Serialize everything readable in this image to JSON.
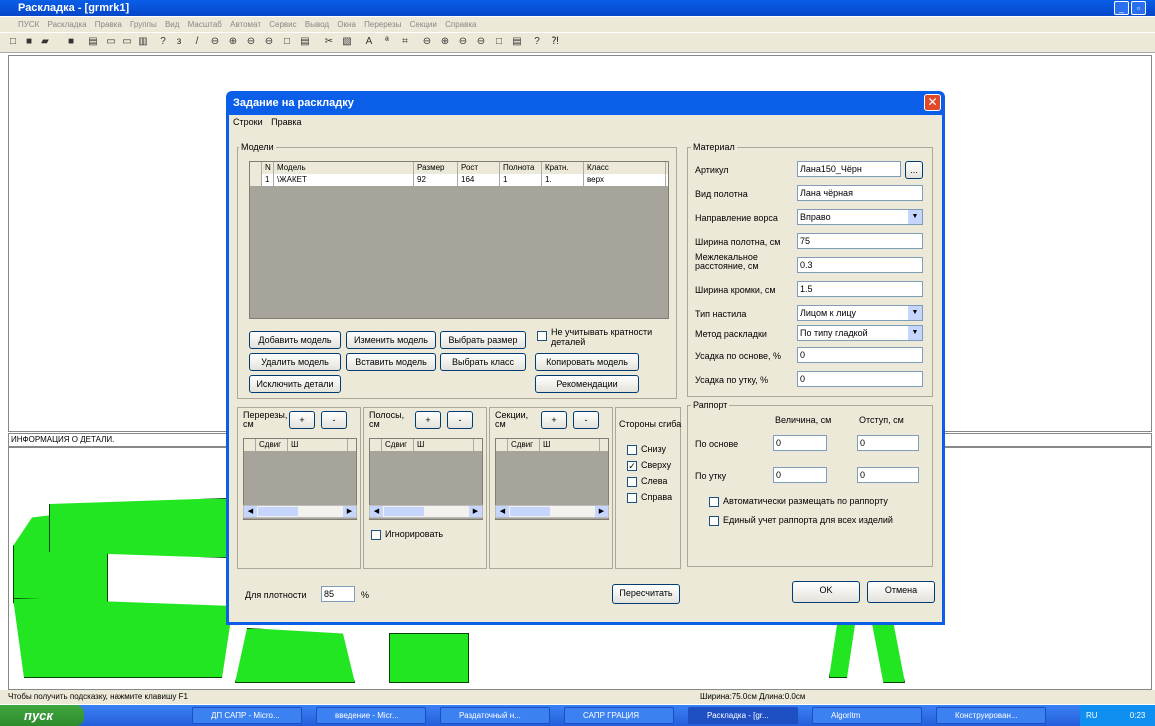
{
  "app": {
    "title": "Раскладка - [grmrk1]",
    "menu": [
      "ПУСК",
      "Раскладка",
      "Правка",
      "Группы",
      "Вид",
      "Масштаб",
      "Автомат",
      "Сервис",
      "Вывод",
      "Окна",
      "Перерезы",
      "Секции",
      "Справка"
    ],
    "info_header": "ИНФОРМАЦИЯ О ДЕТАЛИ.",
    "status_hint": "Чтобы получить подсказку, нажмите клавишу F1",
    "status_size": "Ширина:75.0см Длина:0.0см"
  },
  "dialog": {
    "title": "Задание на раскладку",
    "menu": [
      "Строки",
      "Правка"
    ],
    "models": {
      "label": "Модели",
      "columns": [
        "N",
        "Модель",
        "Размер",
        "Рост",
        "Полнота",
        "Кратн.",
        "Класс"
      ],
      "rows": [
        [
          "1",
          "\\ЖАКЕТ",
          "92",
          "164",
          "1",
          "1.",
          "верх"
        ]
      ],
      "buttons": {
        "add": "Добавить модель",
        "edit": "Изменить модель",
        "pick_size": "Выбрать размер",
        "delete": "Удалить модель",
        "insert": "Вставить модель",
        "pick_class": "Выбрать класс",
        "exclude": "Исключить детали",
        "copy": "Копировать модель",
        "recommend": "Рекомендации"
      },
      "ignore_mult": "Не учитывать кратности деталей"
    },
    "material": {
      "label": "Материал",
      "article_label": "Артикул",
      "article": "Лана150_Чёрн",
      "article_btn": "...",
      "fabric_label": "Вид полотна",
      "fabric": "Лана чёрная",
      "nap_label": "Направление ворса",
      "nap": "Вправо",
      "width_label": "Ширина полотна, см",
      "width": "75",
      "gap_label": "Межлекальное расстояние, см",
      "gap": "0.3",
      "edge_label": "Ширина кромки, см",
      "edge": "1.5",
      "spread_label": "Тип настила",
      "spread": "Лицом к лицу",
      "method_label": "Метод раскладки",
      "method": "По типу гладкой",
      "shrink_warp_label": "Усадка по основе, %",
      "shrink_warp": "0",
      "shrink_weft_label": "Усадка по утку, %",
      "shrink_weft": "0"
    },
    "cuts": {
      "label": "Перерезы, см",
      "plus": "+",
      "minus": "-",
      "cols": [
        "Сдвиг",
        "Ш"
      ]
    },
    "strips": {
      "label": "Полосы, см",
      "plus": "+",
      "minus": "-",
      "cols": [
        "Сдвиг",
        "Ш"
      ],
      "ignore": "Игнорировать"
    },
    "sections": {
      "label": "Секции, см",
      "plus": "+",
      "minus": "-",
      "cols": [
        "Сдвиг",
        "Ш"
      ]
    },
    "fold": {
      "label": "Стороны сгиба",
      "bottom": "Снизу",
      "top": "Сверху",
      "left": "Слева",
      "right": "Справа"
    },
    "rapport": {
      "label": "Раппорт",
      "size_label": "Величина, см",
      "offset_label": "Отступ, см",
      "warp_label": "По основе",
      "weft_label": "По утку",
      "warp_size": "0",
      "warp_offset": "0",
      "weft_size": "0",
      "weft_offset": "0",
      "auto": "Автоматически размещать по раппорту",
      "single": "Единый учет раппорта для всех изделий"
    },
    "density_label": "Для плотности",
    "density": "85",
    "density_unit": "%",
    "recalc": "Пересчитать",
    "ok": "OK",
    "cancel": "Отмена"
  },
  "taskbar": {
    "start": "пуск",
    "tasks": [
      "ДП САПР - Micro...",
      "введение - Micr...",
      "Раздаточный н...",
      "САПР ГРАЦИЯ",
      "Раскладка - [gr...",
      "Algoritm",
      "Конструирован..."
    ],
    "lang": "RU",
    "time": "0:23"
  }
}
